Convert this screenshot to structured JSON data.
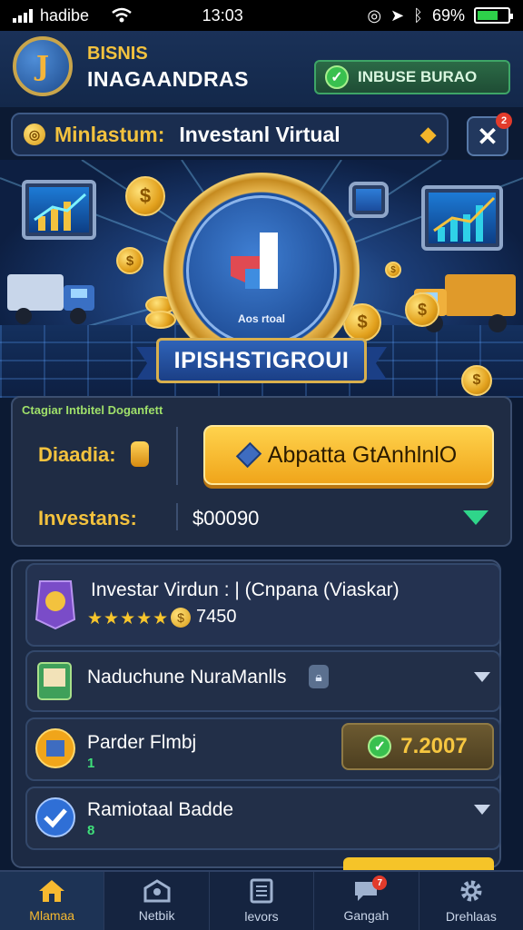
{
  "status_bar": {
    "carrier": "hadibe",
    "time": "13:03",
    "battery_pct_label": "69%",
    "battery_level": 0.69,
    "icons": [
      "signal-icon",
      "wifi-icon",
      "location-icon",
      "bluetooth-icon",
      "battery-icon"
    ]
  },
  "header": {
    "logo_glyph": "J",
    "brand_line1": "BISNIS",
    "brand_line2": "INAGAANDRAS",
    "status_pill": "INBUSE BURAO"
  },
  "title_bar": {
    "prefix": "Minlastum:",
    "title": "Investanl Virtual",
    "close_badge": "2"
  },
  "hero": {
    "portal_caption": "Aos rtoal",
    "ribbon_text": "IPISHSTIGROUI"
  },
  "invest_panel": {
    "caption": "Ctagiar Intbitel Doganfett",
    "balance_label": "Diaadia:",
    "action_button": "Abpatta GtAnhlnlO",
    "investments_label": "Investans:",
    "investments_amount": "$00090"
  },
  "list": {
    "items": [
      {
        "title": "Investar Virdun : | (Cnpana (Viaskar)",
        "stars": "★★★★★",
        "price": "7450"
      },
      {
        "title": "Naduchune NuraManlls"
      },
      {
        "title": "Parder Flmbj",
        "sub": "1",
        "value": "7.2007"
      },
      {
        "title": "Ramiotaal Badde",
        "sub": "8"
      }
    ]
  },
  "nav": {
    "items": [
      {
        "label": "Mlamaa",
        "icon": "home-icon"
      },
      {
        "label": "Netbik",
        "icon": "network-icon"
      },
      {
        "label": "levors",
        "icon": "list-icon"
      },
      {
        "label": "Gangah",
        "icon": "chat-icon",
        "badge": "7"
      },
      {
        "label": "Drehlaas",
        "icon": "gear-icon"
      }
    ]
  },
  "colors": {
    "accent_gold": "#f3c23e",
    "success_green": "#39c04f",
    "panel_bg": "#1f2c44",
    "background": "#0c1a33"
  }
}
